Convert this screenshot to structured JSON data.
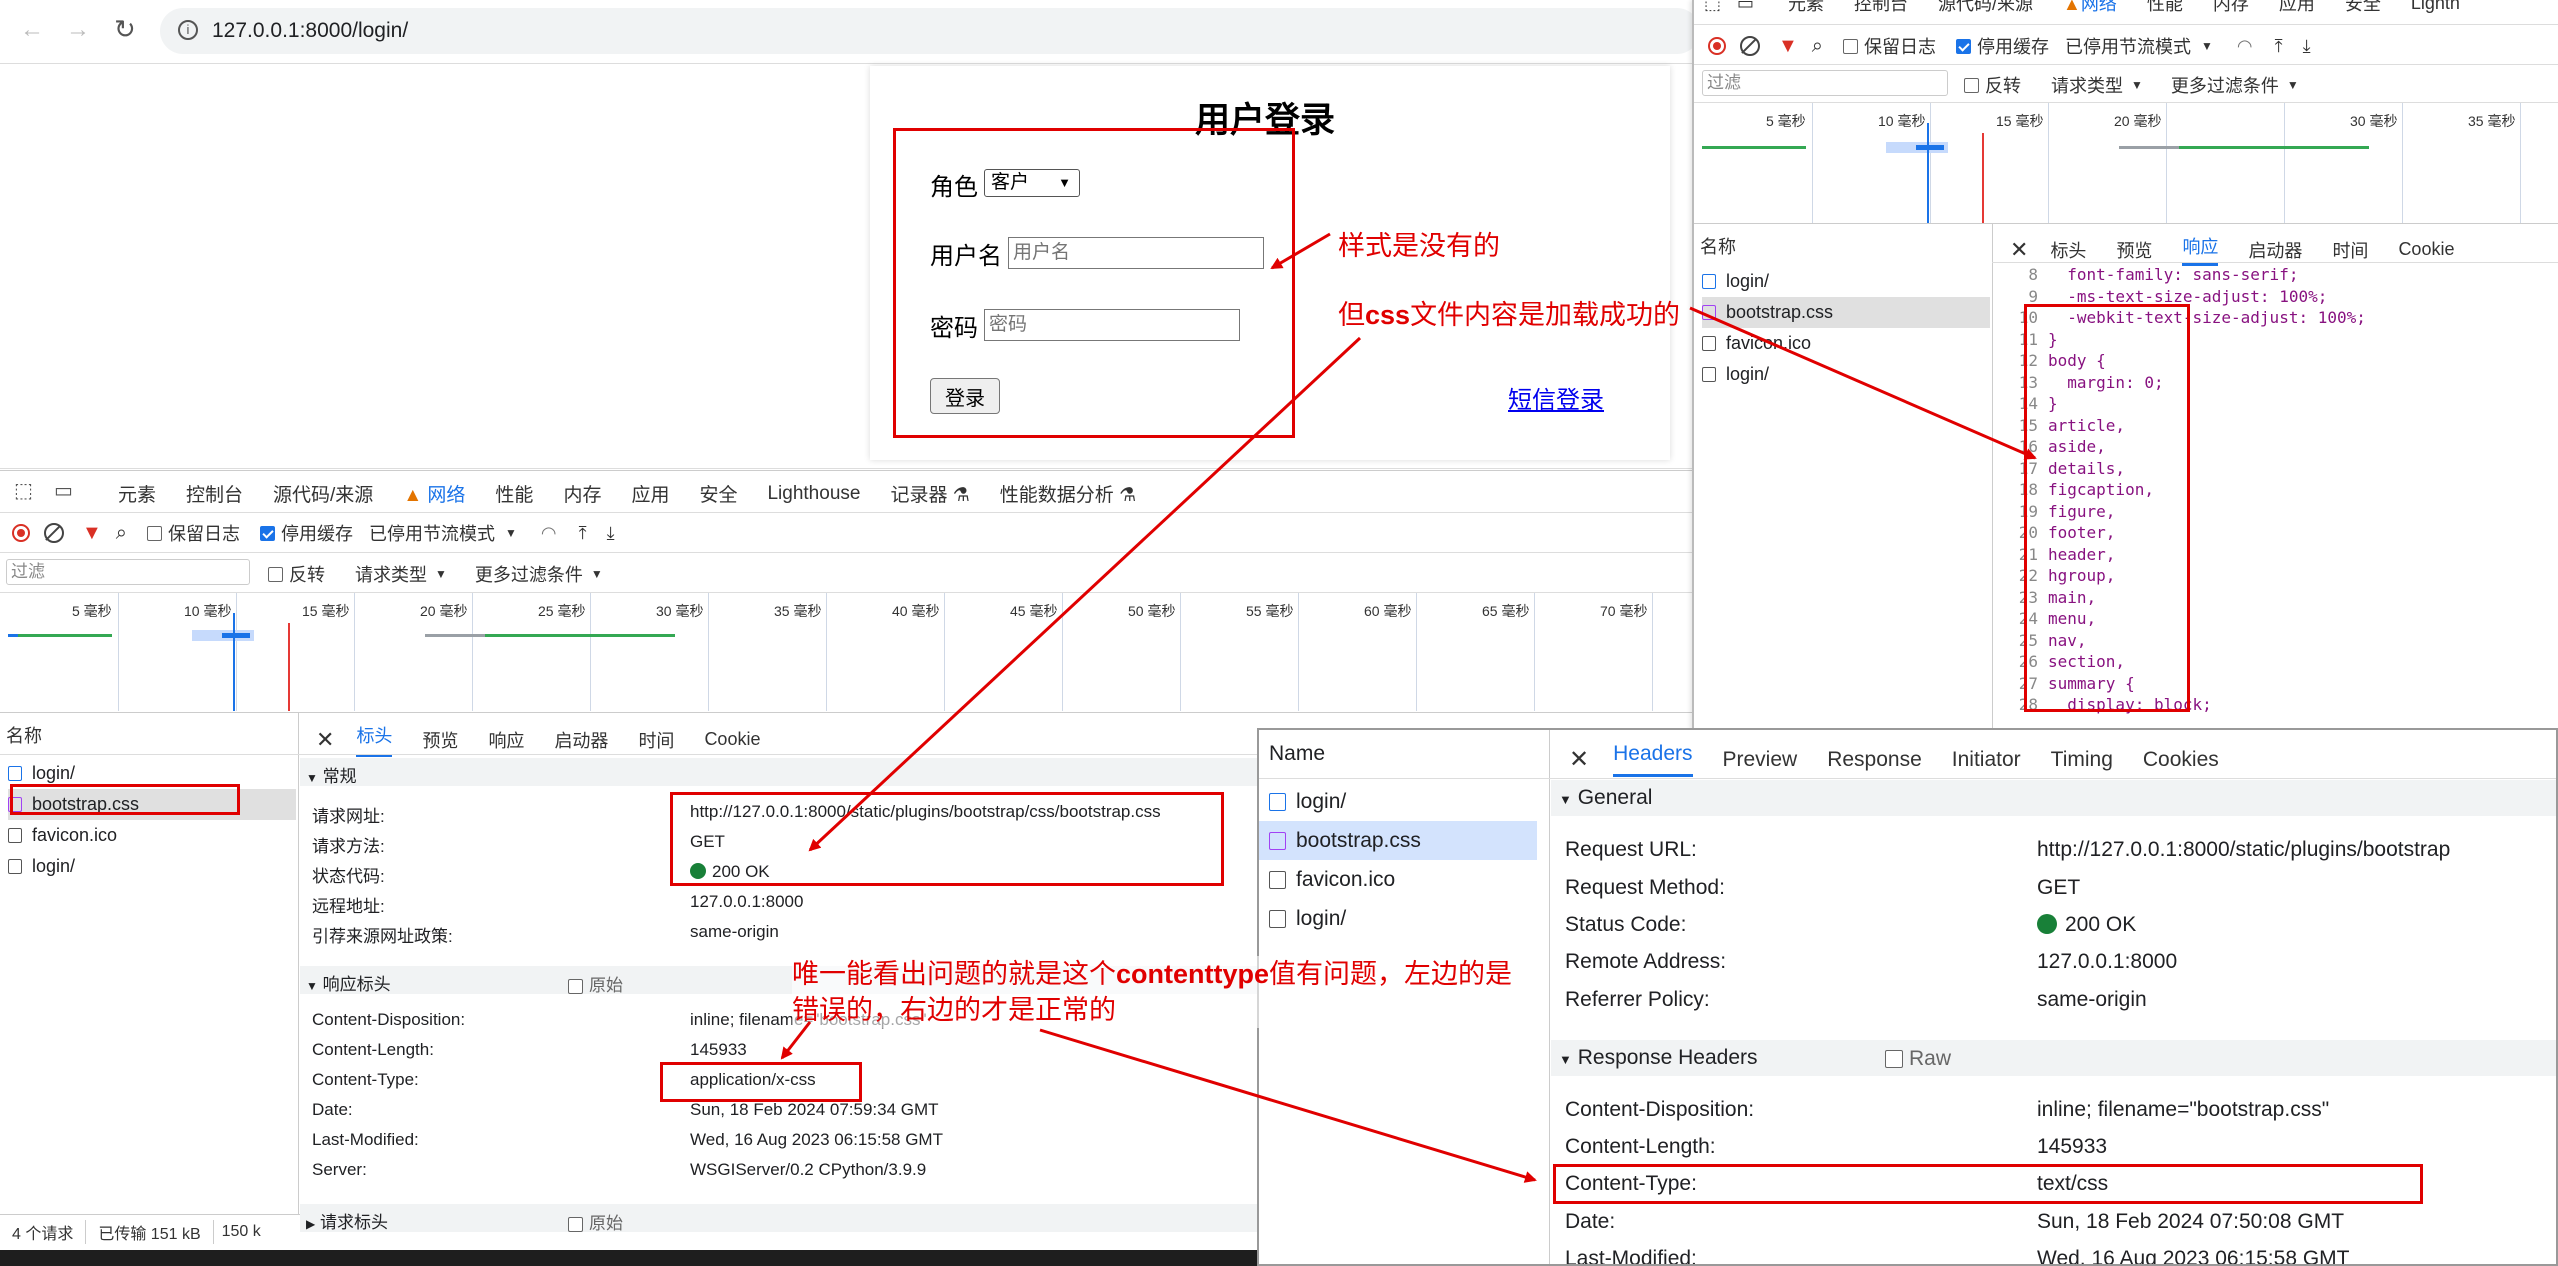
{
  "browser": {
    "url": "127.0.0.1:8000/login/"
  },
  "login": {
    "title": "用户登录",
    "role_label": "角色",
    "role_value": "客户",
    "username_label": "用户名",
    "username_placeholder": "用户名",
    "password_label": "密码",
    "password_placeholder": "密码",
    "submit": "登录",
    "sms_link": "短信登录"
  },
  "annotations": {
    "a1": "样式是没有的",
    "a2_prefix": "但",
    "a2_bold": "css",
    "a2_suffix": "文件内容是加载成功的",
    "a3_line1_prefix": "唯一能看出问题的就是这个",
    "a3_line1_bold": "contenttype",
    "a3_line1_suffix": "值有问题，左边的是",
    "a3_line2": "错误的，右边的才是正常的"
  },
  "devtools_left": {
    "tabs": [
      "元素",
      "控制台",
      "源代码/来源",
      "网络",
      "性能",
      "内存",
      "应用",
      "安全",
      "Lighthouse",
      "记录器",
      "性能数据分析"
    ],
    "preserve_log": "保留日志",
    "disable_cache": "停用缓存",
    "throttle": "已停用节流模式",
    "filter_placeholder": "过滤",
    "invert": "反转",
    "request_types": "请求类型",
    "more_filters": "更多过滤条件",
    "ticks": [
      "5 毫秒",
      "10 毫秒",
      "15 毫秒",
      "20 毫秒",
      "25 毫秒",
      "30 毫秒",
      "35 毫秒",
      "40 毫秒",
      "45 毫秒",
      "50 毫秒",
      "55 毫秒",
      "60 毫秒",
      "65 毫秒",
      "70 毫秒"
    ],
    "name_header": "名称",
    "files": [
      "login/",
      "bootstrap.css",
      "favicon.ico",
      "login/"
    ],
    "detail_tabs": [
      "标头",
      "预览",
      "响应",
      "启动器",
      "时间",
      "Cookie"
    ],
    "general_title": "常规",
    "general": [
      [
        "请求网址:",
        "http://127.0.0.1:8000/static/plugins/bootstrap/css/bootstrap.css"
      ],
      [
        "请求方法:",
        "GET"
      ],
      [
        "状态代码:",
        "200 OK"
      ],
      [
        "远程地址:",
        "127.0.0.1:8000"
      ],
      [
        "引荐来源网址政策:",
        "same-origin"
      ]
    ],
    "response_headers_title": "响应标头",
    "raw_label": "原始",
    "response_headers": [
      [
        "Content-Disposition:",
        "inline; filename=\"bootstrap.css\""
      ],
      [
        "Content-Length:",
        "145933"
      ],
      [
        "Content-Type:",
        "application/x-css"
      ],
      [
        "Date:",
        "Sun, 18 Feb 2024 07:59:34 GMT"
      ],
      [
        "Last-Modified:",
        "Wed, 16 Aug 2023 06:15:58 GMT"
      ],
      [
        "Server:",
        "WSGIServer/0.2 CPython/3.9.9"
      ]
    ],
    "request_headers_title": "请求标头",
    "status_bar": [
      "4 个请求",
      "已传输 151 kB",
      "150 k"
    ]
  },
  "devtools_right": {
    "tabs": [
      "元素",
      "控制台",
      "源代码/来源",
      "网络",
      "性能",
      "内存",
      "应用",
      "安全",
      "Lighth"
    ],
    "preserve_log": "保留日志",
    "disable_cache": "停用缓存",
    "throttle": "已停用节流模式",
    "filter_placeholder": "过滤",
    "invert": "反转",
    "request_types": "请求类型",
    "more_filters": "更多过滤条件",
    "ticks": [
      "5 毫秒",
      "10 毫秒",
      "15 毫秒",
      "20 毫秒",
      "30 毫秒",
      "35 毫秒"
    ],
    "name_header": "名称",
    "files": [
      "login/",
      "bootstrap.css",
      "favicon.ico",
      "login/"
    ],
    "detail_tabs": [
      "标头",
      "预览",
      "响应",
      "启动器",
      "时间",
      "Cookie"
    ],
    "code_lines": [
      [
        "8",
        "  font-family: sans-serif;"
      ],
      [
        "9",
        "  -ms-text-size-adjust: 100%;"
      ],
      [
        "10",
        "  -webkit-text-size-adjust: 100%;"
      ],
      [
        "11",
        "}"
      ],
      [
        "12",
        "body {"
      ],
      [
        "13",
        "  margin: 0;"
      ],
      [
        "14",
        "}"
      ],
      [
        "15",
        "article,"
      ],
      [
        "16",
        "aside,"
      ],
      [
        "17",
        "details,"
      ],
      [
        "18",
        "figcaption,"
      ],
      [
        "19",
        "figure,"
      ],
      [
        "20",
        "footer,"
      ],
      [
        "21",
        "header,"
      ],
      [
        "22",
        "hgroup,"
      ],
      [
        "23",
        "main,"
      ],
      [
        "24",
        "menu,"
      ],
      [
        "25",
        "nav,"
      ],
      [
        "26",
        "section,"
      ],
      [
        "27",
        "summary {"
      ],
      [
        "28",
        "  display: block;"
      ]
    ]
  },
  "devtools_en": {
    "name_header": "Name",
    "files": [
      "login/",
      "bootstrap.css",
      "favicon.ico",
      "login/"
    ],
    "tabs": [
      "Headers",
      "Preview",
      "Response",
      "Initiator",
      "Timing",
      "Cookies"
    ],
    "general_title": "General",
    "general": [
      [
        "Request URL:",
        "http://127.0.0.1:8000/static/plugins/bootstrap"
      ],
      [
        "Request Method:",
        "GET"
      ],
      [
        "Status Code:",
        "200 OK"
      ],
      [
        "Remote Address:",
        "127.0.0.1:8000"
      ],
      [
        "Referrer Policy:",
        "same-origin"
      ]
    ],
    "response_headers_title": "Response Headers",
    "raw_label": "Raw",
    "response_headers": [
      [
        "Content-Disposition:",
        "inline; filename=\"bootstrap.css\""
      ],
      [
        "Content-Length:",
        "145933"
      ],
      [
        "Content-Type:",
        "text/css"
      ],
      [
        "Date:",
        "Sun, 18 Feb 2024 07:50:08 GMT"
      ],
      [
        "Last-Modified:",
        "Wed, 16 Aug 2023 06:15:58 GMT"
      ]
    ]
  }
}
